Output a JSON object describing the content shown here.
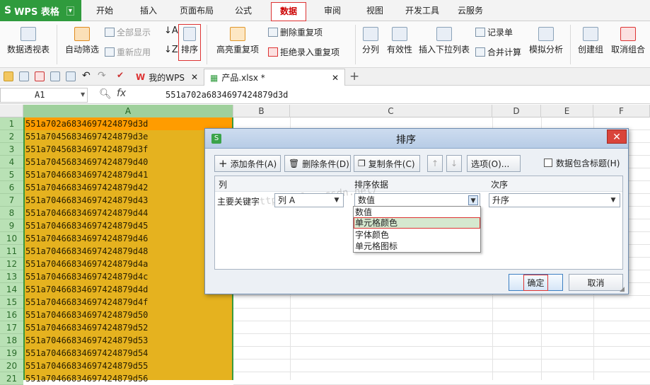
{
  "app": {
    "title": "WPS 表格",
    "logo": "S"
  },
  "menu": {
    "tabs": [
      "开始",
      "插入",
      "页面布局",
      "公式",
      "数据",
      "审阅",
      "视图",
      "开发工具",
      "云服务"
    ],
    "active": "数据"
  },
  "ribbon": {
    "pivot": "数据透视表",
    "autofilter": "自动筛选",
    "show_all": "全部显示",
    "reapply": "重新应用",
    "sort": "排序",
    "highlight_dup": "高亮重复项",
    "remove_dup": "删除重复项",
    "reject_dup": "拒绝录入重复项",
    "split": "分列",
    "validity": "有效性",
    "insert_dropdown": "插入下拉列表",
    "record": "记录单",
    "consolidate": "合并计算",
    "simulate": "模拟分析",
    "group": "创建组",
    "ungroup": "取消组合"
  },
  "doc_tabs": [
    {
      "label": "我的WPS"
    },
    {
      "label": "产品.xlsx *"
    }
  ],
  "formula_bar": {
    "name_box": "A1",
    "fx": "fx",
    "content": "551a702a6834697424879d3d"
  },
  "columns": [
    "A",
    "B",
    "C",
    "D",
    "E",
    "F"
  ],
  "rows": [
    "1",
    "2",
    "3",
    "4",
    "5",
    "6",
    "7",
    "8",
    "9",
    "10",
    "11",
    "12",
    "13",
    "14",
    "15",
    "16",
    "17",
    "18",
    "19",
    "20",
    "21"
  ],
  "cells_A": [
    "551a702a6834697424879d3d",
    "551a70456834697424879d3e",
    "551a70456834697424879d3f",
    "551a70456834697424879d40",
    "551a70466834697424879d41",
    "551a70466834697424879d42",
    "551a70466834697424879d43",
    "551a70466834697424879d44",
    "551a70466834697424879d45",
    "551a70466834697424879d46",
    "551a70466834697424879d48",
    "551a70466834697424879d4a",
    "551a70466834697424879d4c",
    "551a70466834697424879d4d",
    "551a70466834697424879d4f",
    "551a70466834697424879d50",
    "551a70466834697424879d52",
    "551a70466834697424879d53",
    "551a70466834697424879d54",
    "551a70466834697424879d55",
    "551a70466834697424879d56"
  ],
  "dialog": {
    "title": "排序",
    "add_condition": "添加条件(A)",
    "delete_condition": "删除条件(D)",
    "copy_condition": "复制条件(C)",
    "options": "选项(O)...",
    "has_header": "数据包含标题(H)",
    "header_col": "列",
    "header_basis": "排序依据",
    "header_order": "次序",
    "primary_key_label": "主要关键字",
    "column_value": "列 A",
    "basis_value": "数值",
    "order_value": "升序",
    "basis_options": [
      "数值",
      "单元格颜色",
      "字体颜色",
      "单元格图标"
    ],
    "highlighted_option": "单元格颜色",
    "ok": "确定",
    "cancel": "取消",
    "watermark": "http://blog.csdn.net/"
  },
  "colors": {
    "selected_fill": "#e5b21f",
    "active_cell": "#ff9c00",
    "accent_green": "#2f9b3d",
    "highlight_red": "#dd3333"
  }
}
